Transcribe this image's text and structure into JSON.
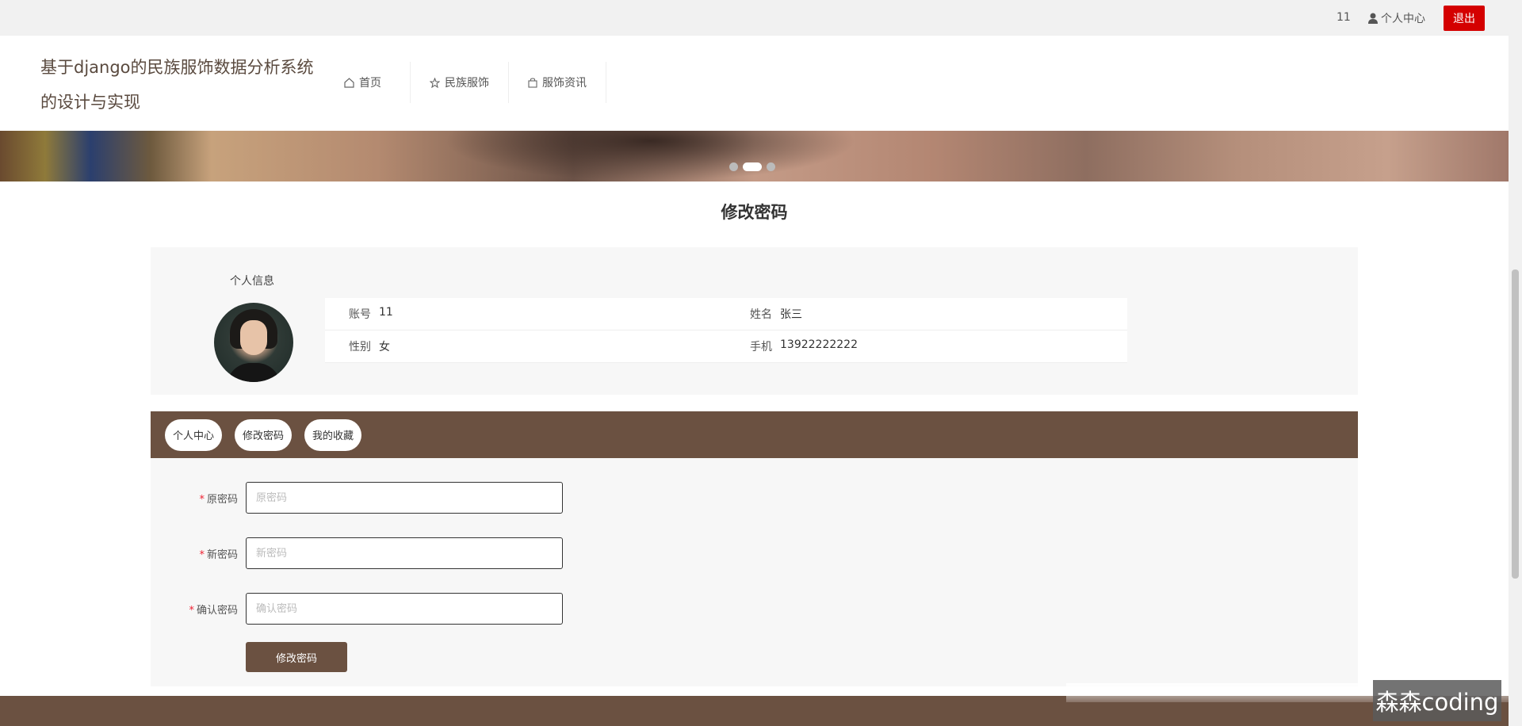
{
  "topbar": {
    "user_id": "11",
    "center_label": "个人中心",
    "logout_label": "退出"
  },
  "header": {
    "site_title": "基于django的民族服饰数据分析系统的设计与实现",
    "nav": [
      {
        "label": "首页",
        "icon": "home-icon"
      },
      {
        "label": "民族服饰",
        "icon": "star-icon"
      },
      {
        "label": "服饰资讯",
        "icon": "bag-icon"
      }
    ]
  },
  "banner": {
    "active_slide": 2,
    "slide_count": 3
  },
  "page": {
    "title": "修改密码"
  },
  "profile": {
    "section_label": "个人信息",
    "fields": [
      {
        "key": "账号",
        "value": "11"
      },
      {
        "key": "姓名",
        "value": "张三"
      },
      {
        "key": "性别",
        "value": "女"
      },
      {
        "key": "手机",
        "value": "13922222222"
      }
    ]
  },
  "tabs": [
    "个人中心",
    "修改密码",
    "我的收藏"
  ],
  "form": {
    "old_password": {
      "label": "原密码",
      "placeholder": "原密码",
      "value": ""
    },
    "new_password": {
      "label": "新密码",
      "placeholder": "新密码",
      "value": ""
    },
    "confirm_password": {
      "label": "确认密码",
      "placeholder": "确认密码",
      "value": ""
    },
    "submit_label": "修改密码"
  },
  "watermark": "森森coding",
  "colors": {
    "brand": "#6b5141",
    "danger": "#d40000"
  }
}
